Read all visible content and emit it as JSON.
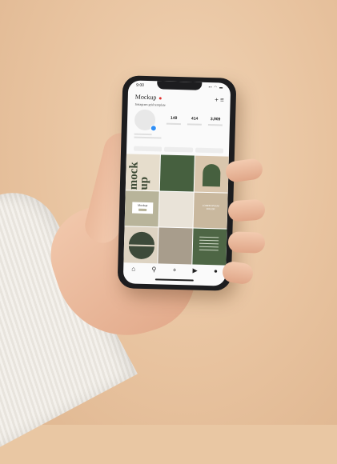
{
  "status_bar": {
    "time": "9:00",
    "indicators": "▪▪ ◠ ▬"
  },
  "profile": {
    "username": "Mockup",
    "subtitle": "Instagram grid template",
    "stats": [
      "149",
      "414",
      "3,909"
    ]
  },
  "grid": {
    "mock_text": "mock up",
    "card_label": "Mockup",
    "center_text": "LOREM IPSUM DOLOR"
  },
  "icons": {
    "header": [
      "plus-icon",
      "menu-icon"
    ],
    "tabbar": [
      "home-icon",
      "search-icon",
      "add-icon",
      "reels-icon",
      "profile-icon"
    ]
  },
  "colors": {
    "background": "#e9c7a3",
    "dark_green": "#46603f",
    "olive": "#b8b49a",
    "sand": "#d9c6ad"
  }
}
